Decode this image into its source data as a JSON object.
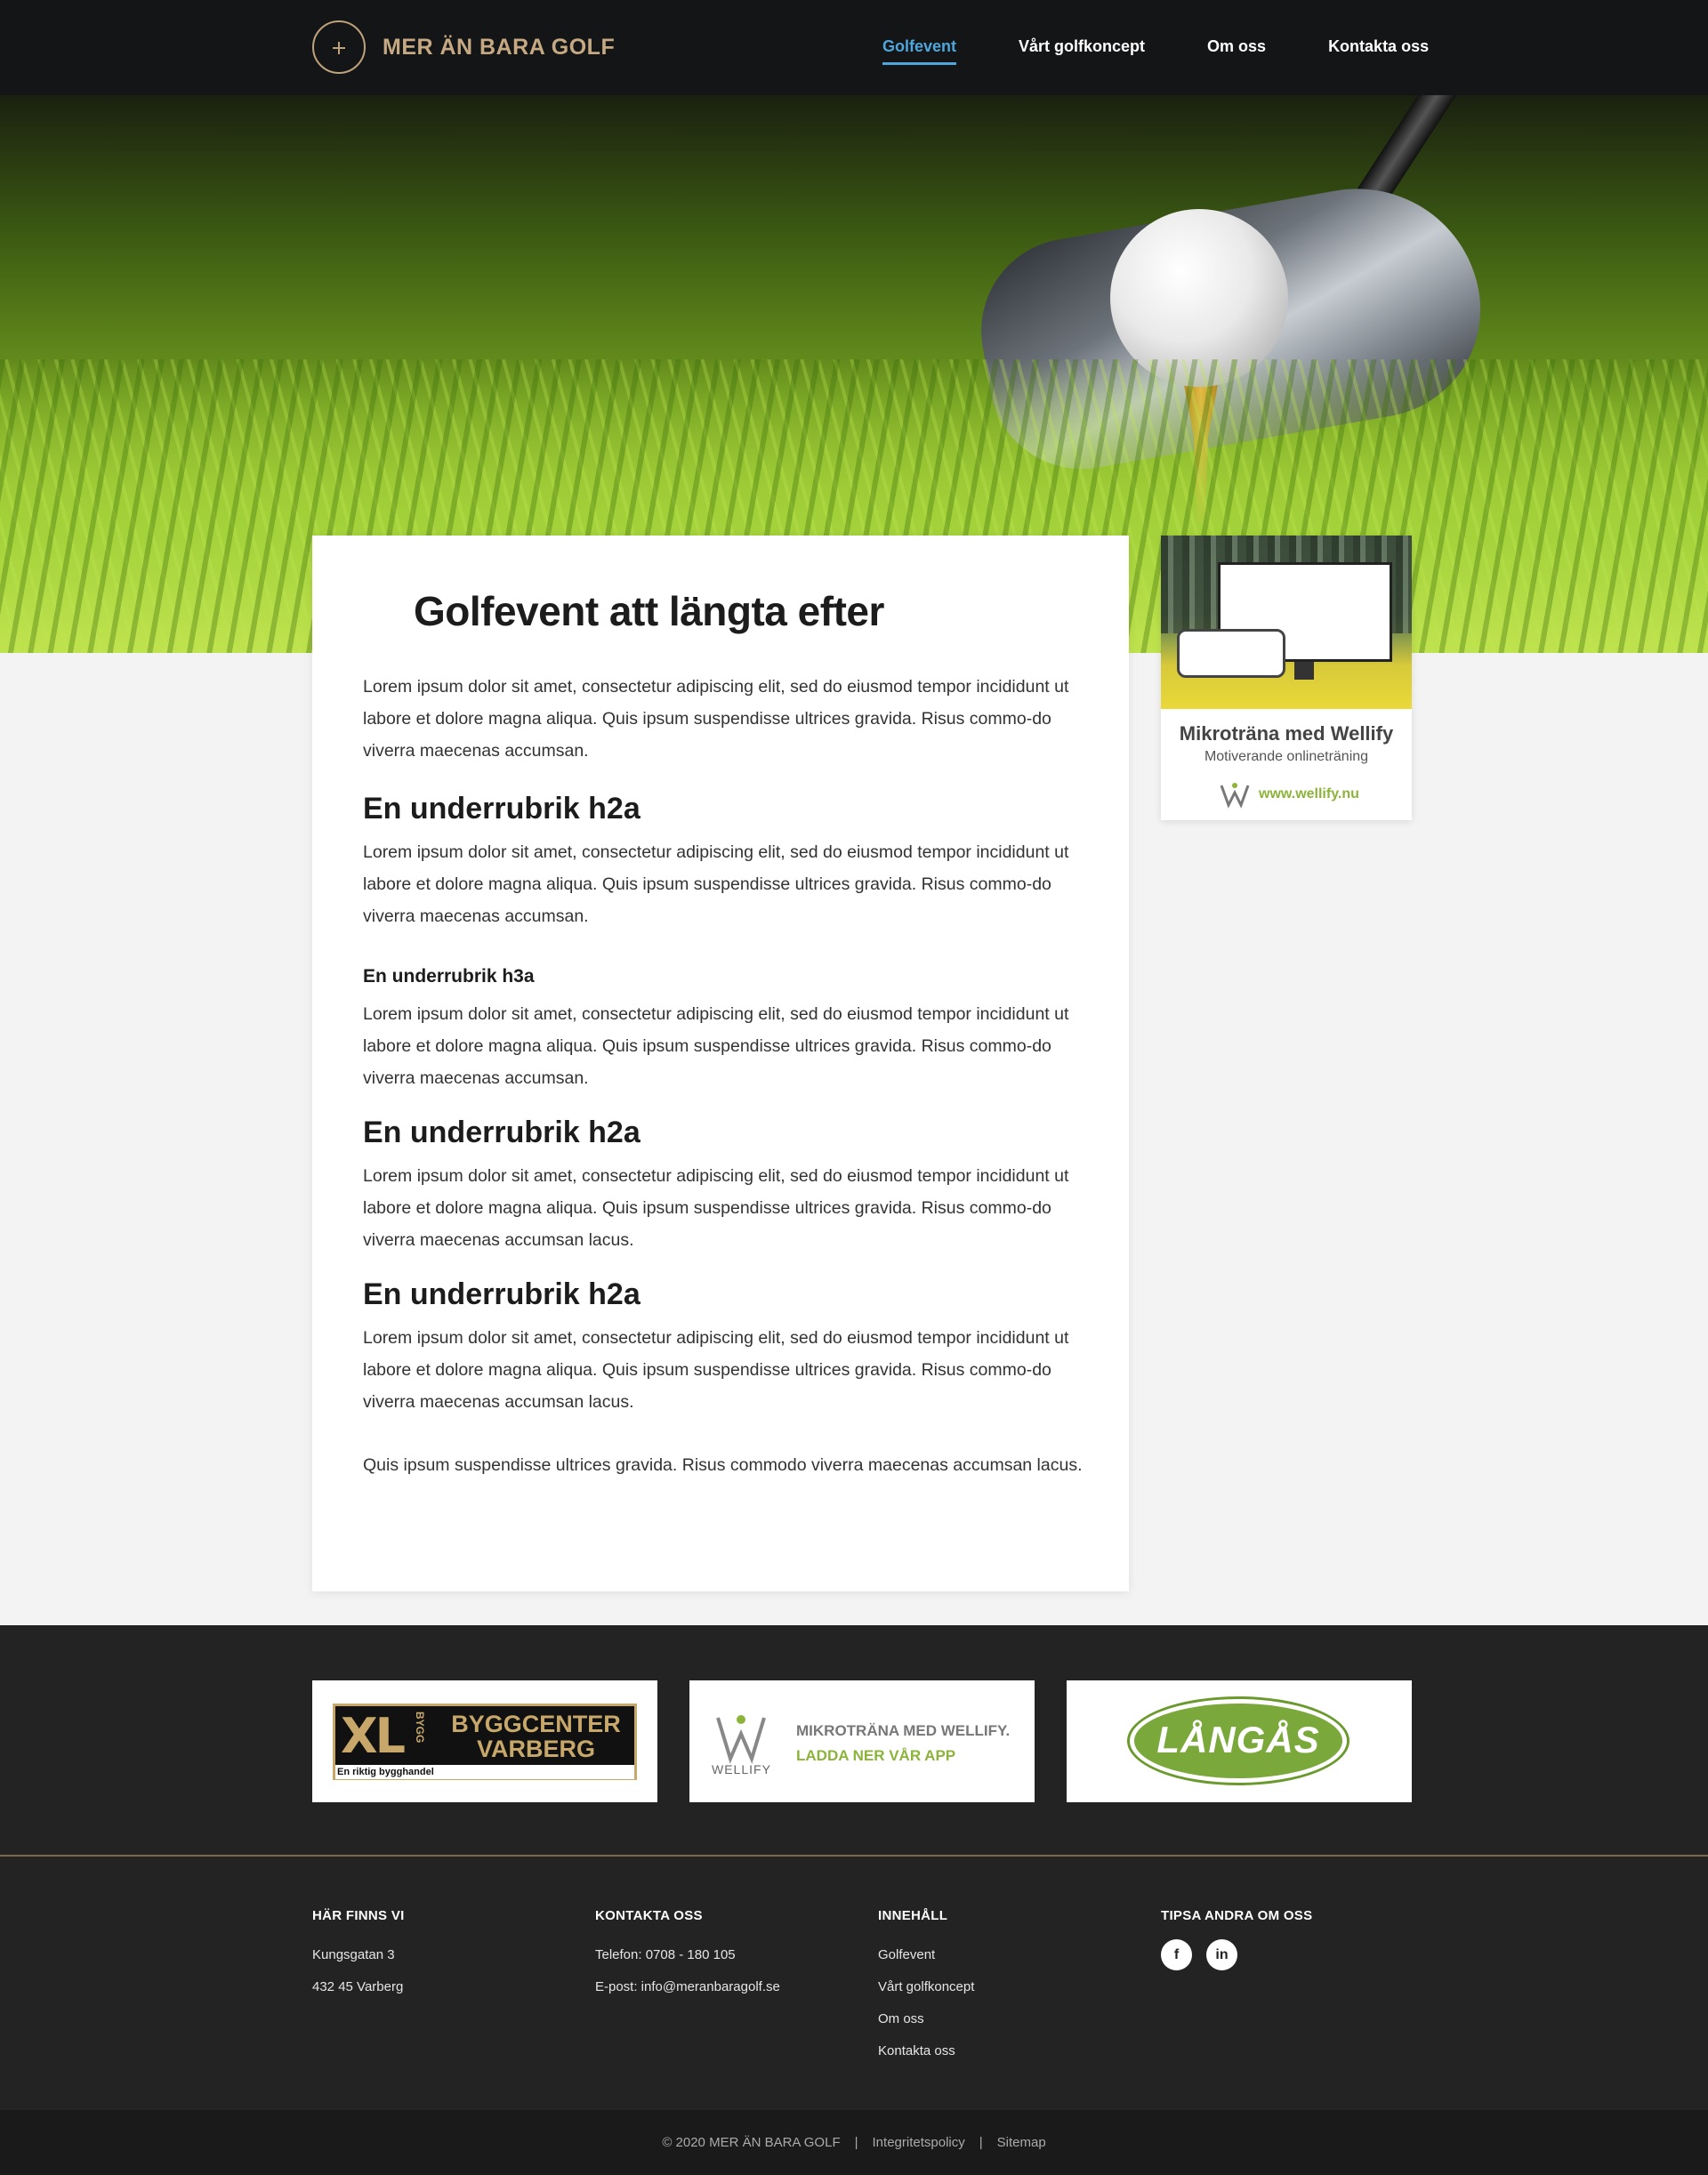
{
  "header": {
    "logo_text": "MER ÄN BARA GOLF",
    "nav": [
      {
        "label": "Golfevent",
        "active": true
      },
      {
        "label": "Vårt golfkoncept",
        "active": false
      },
      {
        "label": "Om oss",
        "active": false
      },
      {
        "label": "Kontakta oss",
        "active": false
      }
    ]
  },
  "article": {
    "title": "Golfevent att längta efter",
    "intro": "Lorem ipsum dolor sit amet, consectetur adipiscing elit, sed do eiusmod tempor incididunt ut labore et dolore magna aliqua. Quis ipsum suspendisse ultrices gravida. Risus commo-do viverra maecenas accumsan.",
    "sections": [
      {
        "heading": "En underrubrik h2a",
        "text": "Lorem ipsum dolor sit amet, consectetur adipiscing elit, sed do eiusmod tempor incididunt ut labore et dolore magna aliqua. Quis ipsum suspendisse ultrices gravida. Risus commo-do viverra maecenas accumsan."
      },
      {
        "heading": "En underrubrik h3a",
        "text": "Lorem ipsum dolor sit amet, consectetur adipiscing elit, sed do eiusmod tempor incididunt ut labore et dolore magna aliqua. Quis ipsum suspendisse ultrices gravida. Risus commo-do viverra maecenas accumsan."
      },
      {
        "heading": "En underrubrik h2a",
        "text": "Lorem ipsum dolor sit amet, consectetur adipiscing elit, sed do eiusmod tempor incididunt ut labore et dolore magna aliqua. Quis ipsum suspendisse ultrices gravida. Risus commo-do viverra maecenas accumsan lacus."
      },
      {
        "heading": "En underrubrik h2a",
        "text": "Lorem ipsum dolor sit amet, consectetur adipiscing elit, sed do eiusmod tempor incididunt ut labore et dolore magna aliqua. Quis ipsum suspendisse ultrices gravida. Risus commo-do viverra maecenas accumsan lacus."
      }
    ],
    "outro": "Quis ipsum suspendisse ultrices gravida. Risus commodo viverra maecenas accumsan lacus."
  },
  "ad": {
    "title": "Mikroträna med Wellify",
    "subtitle": "Motiverande onlineträning",
    "url": "www.wellify.nu"
  },
  "sponsors": {
    "xl": {
      "mark": "XL",
      "bygg": "BYGG",
      "name_line1": "BYGGCENTER",
      "name_line2": "VARBERG",
      "tagline": "En riktig bygghandel"
    },
    "wellify": {
      "wordmark": "WELLIFY",
      "line1": "MIKROTRÄNA MED WELLIFY.",
      "line2": "LADDA NER VÅR APP"
    },
    "langas": {
      "name": "LÅNGÅS"
    }
  },
  "footer": {
    "col1": {
      "title": "HÄR FINNS VI",
      "lines": [
        "Kungsgatan 3",
        "432 45 Varberg"
      ]
    },
    "col2": {
      "title": "KONTAKTA OSS",
      "lines": [
        "Telefon: 0708 - 180 105",
        "E-post: info@meranbaragolf.se"
      ]
    },
    "col3": {
      "title": "INNEHÅLL",
      "links": [
        "Golfevent",
        "Vårt golfkoncept",
        "Om oss",
        "Kontakta oss"
      ]
    },
    "col4": {
      "title": "TIPSA ANDRA OM OSS",
      "social": [
        "f",
        "in"
      ]
    }
  },
  "bottom": {
    "copyright": "© 2020 MER ÄN BARA GOLF",
    "separator": "|",
    "links": [
      "Integritetspolicy",
      "Sitemap"
    ]
  },
  "colors": {
    "accent_gold": "#c6a983",
    "nav_active": "#4ea6dc",
    "wellify_green": "#8cb43a",
    "footer_bg": "#232323"
  }
}
